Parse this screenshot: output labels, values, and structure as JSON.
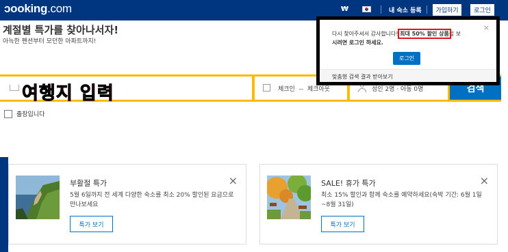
{
  "header": {
    "logo_main": "ɔooking",
    "logo_suffix": ".com",
    "currency": "₩",
    "list_property": "내 숙소 등록",
    "signup": "가입하기",
    "login": "로그인"
  },
  "hero": {
    "title": "계절별 특가를 찾아나서자!",
    "subtitle": "아늑한 펜션부터 모던한 아파트까지!"
  },
  "search": {
    "destination_annotation": "여행지 입력",
    "checkin": "체크인",
    "checkout_sep": "--",
    "checkout": "체크아웃",
    "guests": "성인 2명 · 아동 0명",
    "search_button": "검색"
  },
  "business_trip": "출장입니다",
  "popup": {
    "msg_prefix": "다시 찾아주셔서 감사합니다! ",
    "msg_highlight": "최대 50% 할인 상품",
    "msg_mid": "을 보",
    "msg_line2": "시려면 로그인 하세요.",
    "close": "×",
    "login_button": "로그인",
    "footer": "맞춤형 검색 결과 받아보기"
  },
  "cards": [
    {
      "title": "부활절 특가",
      "description": "5월 6일까지 전 세계 다양한 숙소를 최소 20% 할인된 요금으로 만나보세요",
      "button": "특가 보기",
      "close": "×",
      "image": "coastal-cliff"
    },
    {
      "title": "SALE! 휴가 특가",
      "description": "최소 15% 할인과 함께 숙소를 예약하세요(숙박 기간: 6월 1일~8월 31일)",
      "button": "특가 보기",
      "close": "×",
      "image": "autumn-park-path"
    }
  ],
  "colors": {
    "brand_blue": "#003580",
    "accent_blue": "#0071c2",
    "search_yellow": "#febb02",
    "annotation_red": "#e3131b"
  }
}
